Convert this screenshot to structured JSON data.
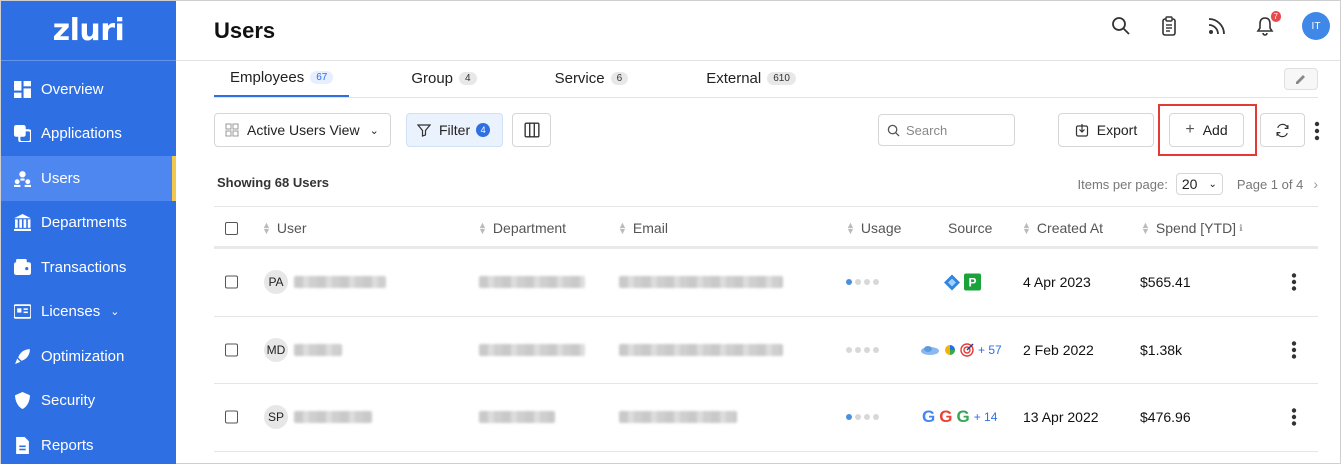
{
  "brand": {
    "logo_text": "zluri",
    "sidebar_bg": "#2f6fe4",
    "accent": "#2f6fe4",
    "active_bar": "#f2c94c"
  },
  "sidebar": {
    "items": [
      {
        "label": "Overview",
        "icon": "dashboard-icon"
      },
      {
        "label": "Applications",
        "icon": "applications-icon"
      },
      {
        "label": "Users",
        "icon": "users-icon",
        "active": true
      },
      {
        "label": "Departments",
        "icon": "bank-icon"
      },
      {
        "label": "Transactions",
        "icon": "wallet-icon"
      },
      {
        "label": "Licenses",
        "icon": "license-icon",
        "has_dropdown": true
      },
      {
        "label": "Optimization",
        "icon": "rocket-icon"
      },
      {
        "label": "Security",
        "icon": "shield-icon"
      },
      {
        "label": "Reports",
        "icon": "report-icon"
      }
    ]
  },
  "header": {
    "title": "Users",
    "notification_count": "7",
    "avatar_initials": "IT"
  },
  "tabs": [
    {
      "label": "Employees",
      "count": "67",
      "active": true
    },
    {
      "label": "Group",
      "count": "4"
    },
    {
      "label": "Service",
      "count": "6"
    },
    {
      "label": "External",
      "count": "610"
    }
  ],
  "toolbar": {
    "view_label": "Active Users View",
    "filter_label": "Filter",
    "filter_count": "4",
    "search_placeholder": "Search",
    "export_label": "Export",
    "add_label": "Add"
  },
  "meta": {
    "showing": "Showing 68 Users",
    "items_per_page_label": "Items per page:",
    "items_per_page": "20",
    "page_info": "Page 1 of 4"
  },
  "table": {
    "columns": {
      "user": "User",
      "department": "Department",
      "email": "Email",
      "usage": "Usage",
      "source": "Source",
      "created_at": "Created At",
      "spend": "Spend [YTD]"
    },
    "rows": [
      {
        "initials": "PA",
        "usage_level": 1,
        "sources": [
          "azure-ad-icon",
          "pipedrive-icon"
        ],
        "source_more": "",
        "created_at": "4 Apr 2023",
        "spend": "$565.41"
      },
      {
        "initials": "MD",
        "usage_level": 0,
        "sources": [
          "cloud-app-icon",
          "pie-app-icon",
          "target-app-icon"
        ],
        "source_more": "+ 57",
        "created_at": "2 Feb 2022",
        "spend": "$1.38k"
      },
      {
        "initials": "SP",
        "usage_level": 1,
        "sources": [
          "google-icon",
          "google-icon",
          "google-icon"
        ],
        "source_more": "+ 14",
        "created_at": "13 Apr 2022",
        "spend": "$476.96"
      }
    ]
  }
}
